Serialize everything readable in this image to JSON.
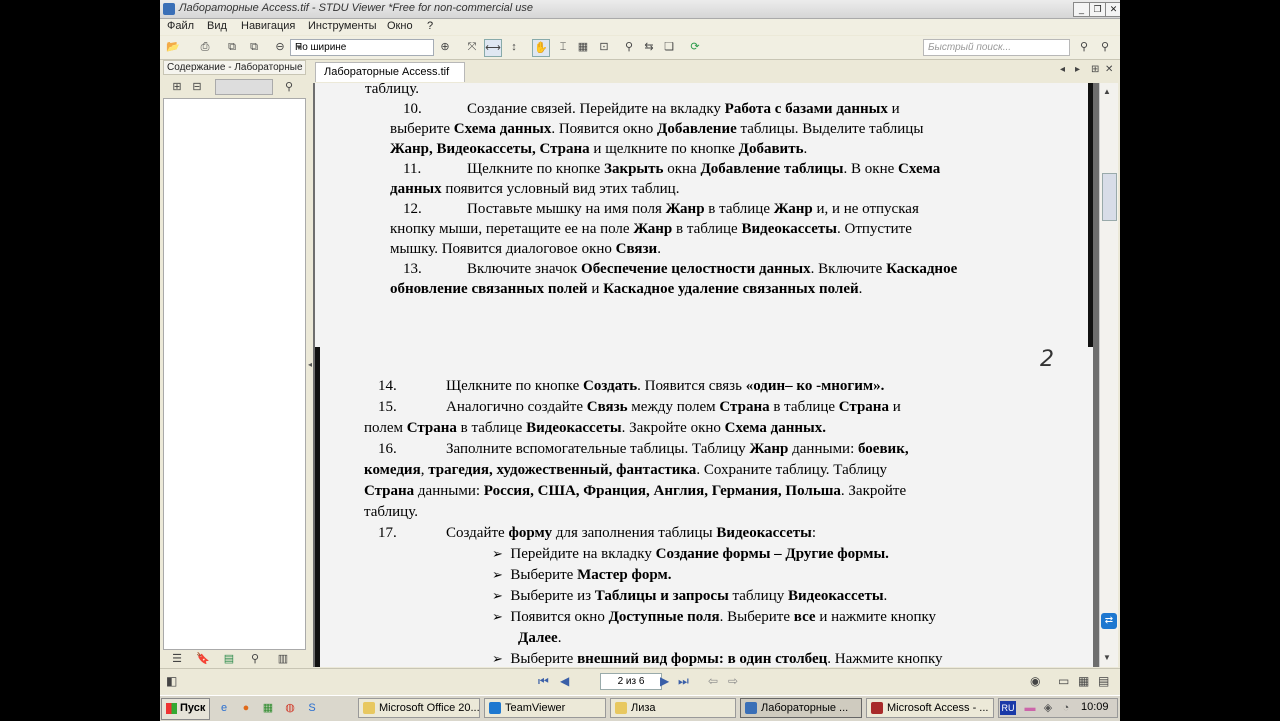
{
  "window": {
    "title": "Лабораторные Access.tif - STDU Viewer *Free for non-commercial use"
  },
  "menu": [
    "Файл",
    "Вид",
    "Навигация",
    "Инструменты",
    "Окно",
    "?"
  ],
  "toolbar": {
    "zoom_value": "По ширине",
    "search_placeholder": "Быстрый поиск..."
  },
  "sidebar": {
    "title": "Содержание - Лабораторные"
  },
  "tab": {
    "label": "Лабораторные Access.tif"
  },
  "document": {
    "page1": [
      "таблицу.",
      "10.",
      "Создание связей. Перейдите на вкладку ",
      "Работа с базами данных",
      " и",
      "выберите ",
      "Схема данных",
      ". Появится окно ",
      "Добавление",
      " таблицы. Выделите таблицы",
      "Жанр, Видеокассеты, Страна",
      " и щелкните по кнопке ",
      "Добавить",
      ".",
      "11.",
      "Щелкните по кнопке ",
      "Закрыть",
      " окна ",
      "Добавление таблицы",
      ". В окне ",
      "Схема",
      "данных",
      " появится условный вид этих таблиц.",
      "12.",
      "Поставьте мышку на имя поля ",
      "Жанр",
      " в таблице ",
      "Жанр",
      " и, и не отпуская",
      "кнопку мыши, перетащите ее на поле ",
      "Жанр",
      " в таблице ",
      "Видеокассеты",
      ". Отпустите",
      "мышку. Появится диалоговое окно ",
      "Связи",
      ".",
      "13.",
      "Включите значок ",
      "Обеспечение целостности данных",
      ". Включите ",
      "Каскадное",
      "обновление связанных полей",
      " и ",
      "Каскадное удаление связанных полей",
      "."
    ],
    "page2": [
      "14.",
      "Щелкните по кнопке ",
      "Создать",
      ". Появится связь ",
      "«один– ко -многим».",
      "15.",
      "Аналогично создайте ",
      "Связь",
      " между полем ",
      "Страна",
      " в таблице ",
      "Страна",
      " и",
      "полем ",
      "Страна",
      " в таблице ",
      "Видеокассеты",
      ". Закройте окно ",
      "Схема данных.",
      "16.",
      "Заполните вспомогательные таблицы. Таблицу ",
      "Жанр",
      " данными: ",
      "боевик,",
      "комедия",
      ", ",
      "трагедия, художественный, фантастика",
      ". Сохраните таблицу. Таблицу",
      "Страна",
      " данными: ",
      "Россия, США, Франция, Англия, Германия, Польша",
      ". Закройте",
      "таблицу.",
      "17.",
      "Создайте ",
      "форму",
      " для заполнения таблицы ",
      "Видеокассеты",
      ":",
      "Перейдите на вкладку ",
      "Создание формы – Другие формы.",
      "Выберите ",
      "Мастер форм.",
      "Выберите из ",
      "Таблицы и запросы",
      " таблицу ",
      "Видеокассеты",
      ".",
      "Появится окно ",
      "Доступные поля",
      ".  Выберите ",
      "все",
      " и нажмите кнопку",
      "Далее",
      ".",
      "Выберите ",
      "внешний вид формы: в один столбец",
      ". Нажмите кнопку",
      "2"
    ]
  },
  "status": {
    "page_indicator": "2 из 6"
  },
  "taskbar": {
    "start": "Пуск",
    "items": [
      "Microsoft Office 20...",
      "TeamViewer",
      "Лиза",
      "Лабораторные ...",
      "Microsoft Access - ..."
    ],
    "lang": "RU",
    "clock": "10:09"
  },
  "colors": {
    "accent": "#3a6fb7",
    "viewer_bg": "#6e6e6e"
  }
}
